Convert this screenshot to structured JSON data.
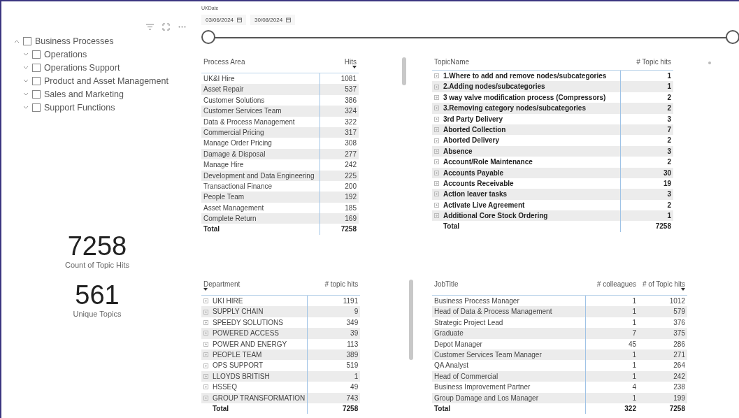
{
  "slicer_tree": {
    "items": [
      {
        "label": "Business Processes",
        "checked": false,
        "expanded": true,
        "children": [
          {
            "label": "Operations",
            "checked": false,
            "expanded": false
          },
          {
            "label": "Operations Support",
            "checked": false,
            "expanded": false
          },
          {
            "label": "Product and Asset Management",
            "checked": false,
            "expanded": false
          },
          {
            "label": "Sales and Marketing",
            "checked": false,
            "expanded": false
          },
          {
            "label": "Support Functions",
            "checked": false,
            "expanded": false
          }
        ]
      }
    ]
  },
  "cards": [
    {
      "value": "7258",
      "label": "Count of Topic Hits"
    },
    {
      "value": "561",
      "label": "Unique Topics"
    }
  ],
  "date_slicer": {
    "title": "UKDate",
    "start": "03/06/2024",
    "end": "30/08/2024"
  },
  "tables": [
    {
      "expandable": false,
      "bold_rows": false,
      "columns": [
        {
          "label": "Process Area",
          "sorted": false
        },
        {
          "label": "Hits",
          "sorted": true
        }
      ],
      "rows": [
        [
          "UK&I Hire",
          "1081"
        ],
        [
          "Asset Repair",
          "537"
        ],
        [
          "Customer Solutions",
          "386"
        ],
        [
          "Customer Services Team",
          "324"
        ],
        [
          "Data & Process Management",
          "322"
        ],
        [
          "Commercial Pricing",
          "317"
        ],
        [
          "Manage Order Pricing",
          "308"
        ],
        [
          "Damage & Disposal",
          "277"
        ],
        [
          "Manage Hire",
          "242"
        ],
        [
          "Development and Data Engineering",
          "225"
        ],
        [
          "Transactional Finance",
          "200"
        ],
        [
          "People Team",
          "192"
        ],
        [
          "Asset Management",
          "185"
        ],
        [
          "Complete Return",
          "169"
        ]
      ],
      "total": [
        "Total",
        "7258"
      ],
      "scrollbar": true
    },
    {
      "expandable": true,
      "bold_rows": true,
      "columns": [
        {
          "label": "TopicName",
          "sorted": false
        },
        {
          "label": "# Topic hits",
          "sorted": false
        }
      ],
      "rows": [
        [
          "1.Where to add and remove nodes/subcategories",
          "1"
        ],
        [
          "2.Adding nodes/subcategories",
          "1"
        ],
        [
          "3 way valve modification process (Compressors)",
          "2"
        ],
        [
          "3.Removing category nodes/subcategories",
          "2"
        ],
        [
          "3rd Party Delivery",
          "3"
        ],
        [
          "Aborted Collection",
          "7"
        ],
        [
          "Aborted Delivery",
          "2"
        ],
        [
          "Absence",
          "3"
        ],
        [
          "Account/Role Maintenance",
          "2"
        ],
        [
          "Accounts Payable",
          "30"
        ],
        [
          "Accounts Receivable",
          "19"
        ],
        [
          "Action leaver tasks",
          "3"
        ],
        [
          "Activate Live Agreement",
          "2"
        ],
        [
          "Additional Core Stock Ordering",
          "1"
        ]
      ],
      "total": [
        "Total",
        "7258"
      ],
      "scrollbar": false
    },
    {
      "expandable": true,
      "bold_rows": false,
      "columns": [
        {
          "label": "Department",
          "sorted": true
        },
        {
          "label": "# topic hits",
          "sorted": false
        }
      ],
      "rows": [
        [
          "UKI HIRE",
          "1191"
        ],
        [
          "SUPPLY CHAIN",
          "9"
        ],
        [
          "SPEEDY SOLUTIONS",
          "349"
        ],
        [
          "POWERED ACCESS",
          "39"
        ],
        [
          "POWER AND ENERGY",
          "113"
        ],
        [
          "PEOPLE TEAM",
          "389"
        ],
        [
          "OPS SUPPORT",
          "519"
        ],
        [
          "LLOYDS BRITISH",
          "1"
        ],
        [
          "HSSEQ",
          "49"
        ],
        [
          "GROUP TRANSFORMATION",
          "743"
        ]
      ],
      "total": [
        "Total",
        "7258"
      ],
      "scrollbar": true
    },
    {
      "expandable": false,
      "bold_rows": false,
      "columns": [
        {
          "label": "JobTitle",
          "sorted": false
        },
        {
          "label": "# colleagues",
          "sorted": false
        },
        {
          "label": "# of Topic hits",
          "sorted": true
        }
      ],
      "rows": [
        [
          "Business Process Manager",
          "1",
          "1012"
        ],
        [
          "Head of Data & Process Management",
          "1",
          "579"
        ],
        [
          "Strategic Project Lead",
          "1",
          "376"
        ],
        [
          "Graduate",
          "7",
          "375"
        ],
        [
          "Depot Manager",
          "45",
          "286"
        ],
        [
          "Customer Services Team Manager",
          "1",
          "271"
        ],
        [
          "QA Analyst",
          "1",
          "264"
        ],
        [
          "Head of Commercial",
          "1",
          "242"
        ],
        [
          "Business Improvement Partner",
          "4",
          "238"
        ],
        [
          "Group Damage and Los Manager",
          "1",
          "199"
        ]
      ],
      "total": [
        "Total",
        "322",
        "7258"
      ],
      "scrollbar": false
    }
  ]
}
